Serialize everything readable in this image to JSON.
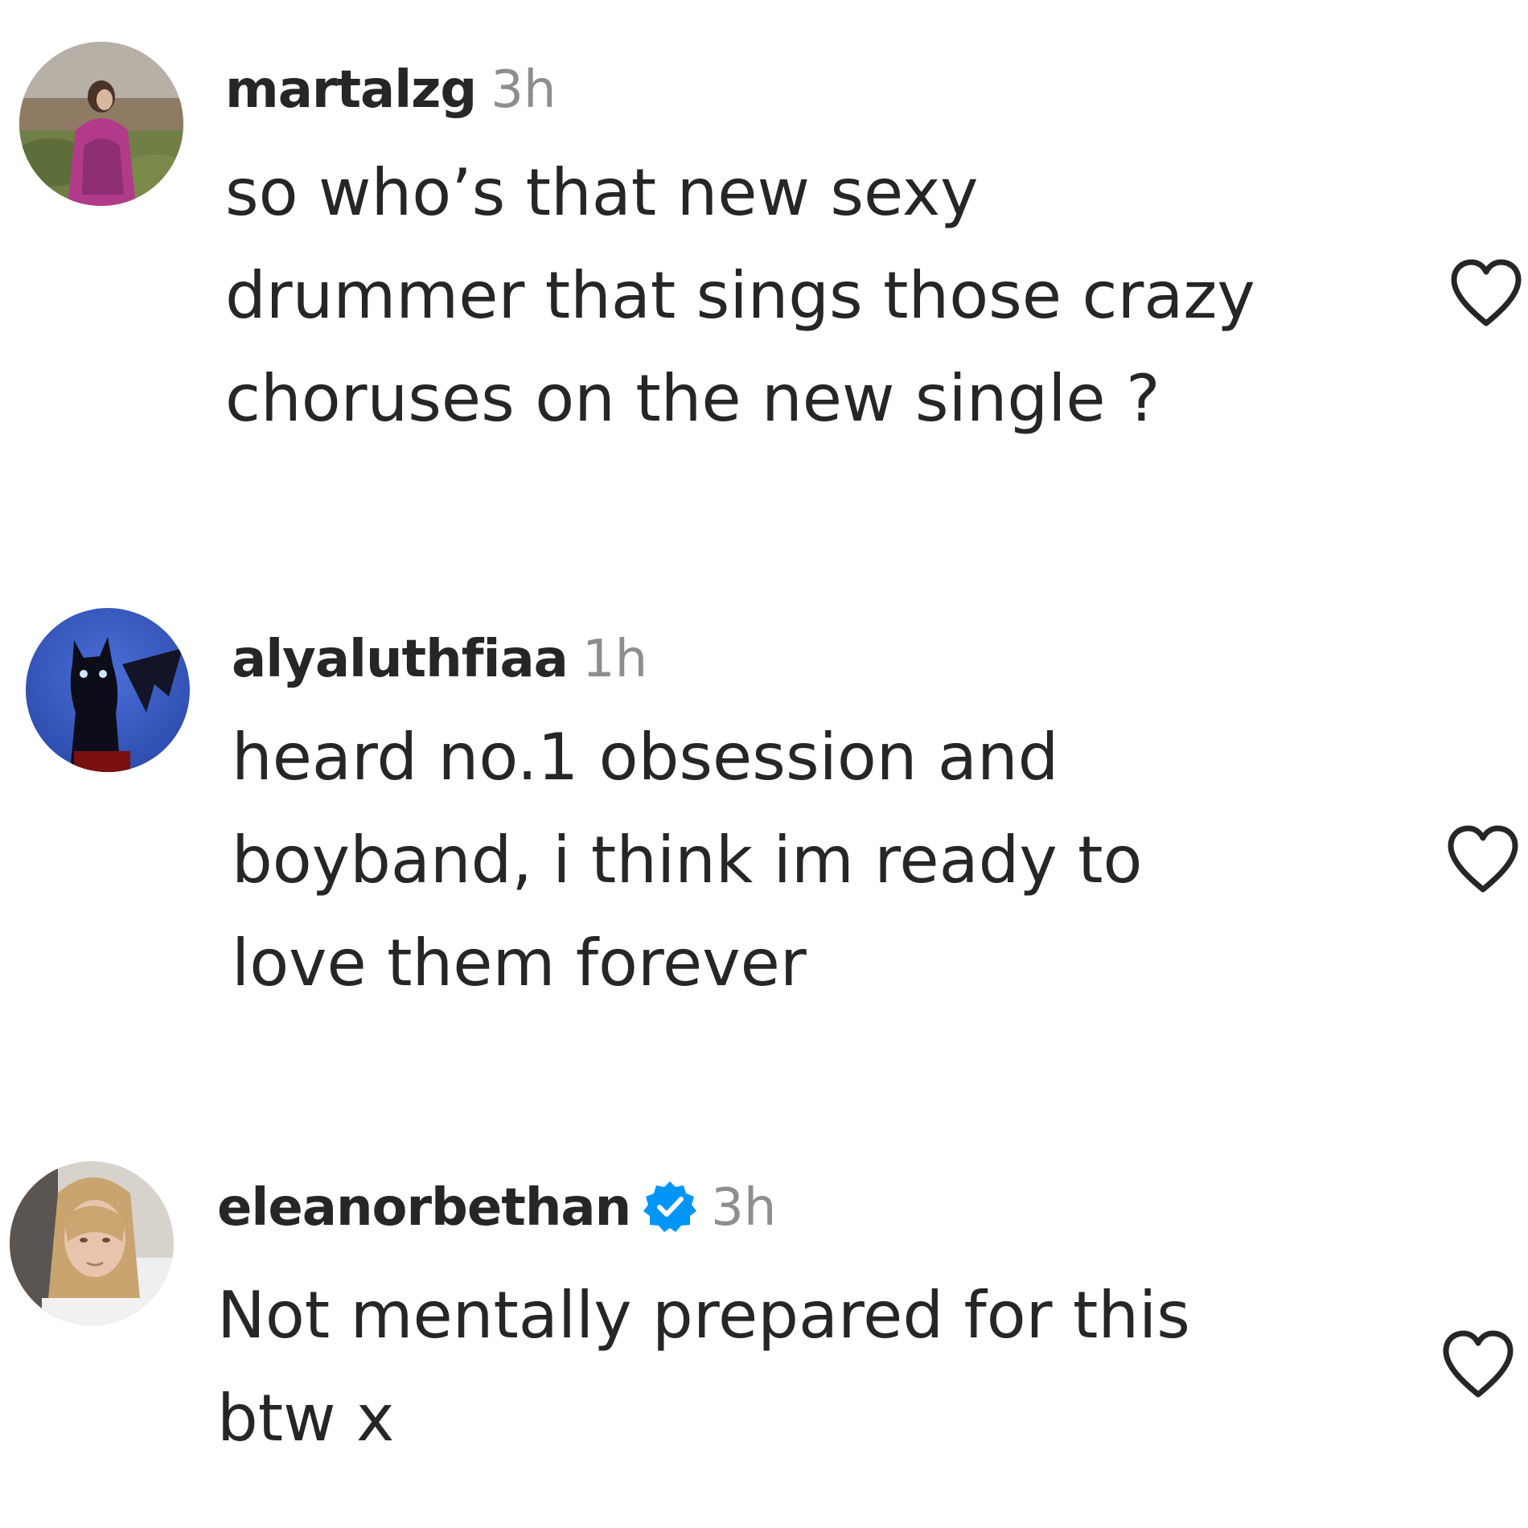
{
  "comments": [
    {
      "username": "martalzg",
      "time": "3h",
      "verified": false,
      "text": "so who’s that new sexy\ndrummer that sings those crazy\nchoruses on the new single ?",
      "avatar_icon": "avatar-photo-field",
      "like_icon": "heart-outline-icon"
    },
    {
      "username": "alyaluthfiaa",
      "time": "1h",
      "verified": false,
      "text": "heard no.1 obsession and\nboyband, i think im ready to\nlove them forever",
      "avatar_icon": "avatar-photo-black-cat",
      "like_icon": "heart-outline-icon"
    },
    {
      "username": "eleanorbethan",
      "time": "3h",
      "verified": true,
      "text": "Not mentally prepared for this\nbtw x",
      "avatar_icon": "avatar-photo-selfie",
      "like_icon": "heart-outline-icon"
    }
  ],
  "colors": {
    "text": "#262626",
    "muted": "#8e8e8e",
    "verified_blue": "#0095f6"
  }
}
